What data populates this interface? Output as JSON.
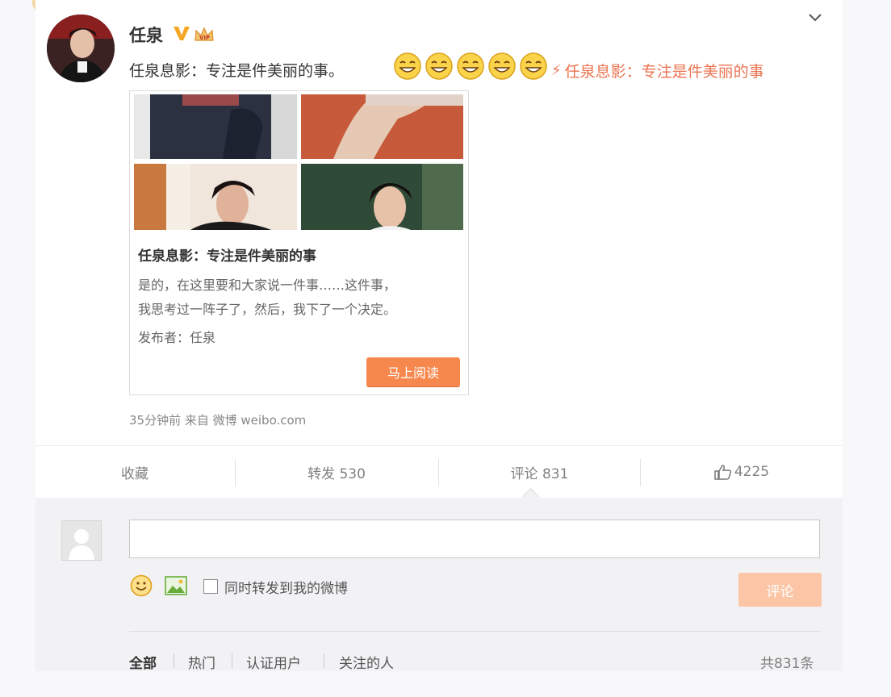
{
  "post": {
    "user_name": "任泉",
    "verified_icon": "v-verified-icon",
    "text": "任泉息影：专注是件美丽的事。",
    "emoji_count": 5,
    "link_text": "任泉息影：专注是件美丽的事",
    "meta": "35分钟前 来自 微博 weibo.com"
  },
  "article": {
    "title": "任泉息影：专注是件美丽的事",
    "desc_line1": "是的，在这里要和大家说一件事……这件事，",
    "desc_line2": "我思考过一阵子了，然后，我下了一个决定。",
    "publisher": "发布者：任泉",
    "read_button": "马上阅读"
  },
  "actions": {
    "favorite": "收藏",
    "repost": "转发 530",
    "comment": "评论 831",
    "like": "4225"
  },
  "comment_box": {
    "repost_option": "同时转发到我的微博",
    "submit": "评论"
  },
  "filters": {
    "all": "全部",
    "hot": "热门",
    "verified": "认证用户",
    "following": "关注的人",
    "total": "共831条"
  },
  "colors": {
    "accent": "#eb7350",
    "button_orange": "#f7884d",
    "verified_gold": "#f5a623"
  }
}
